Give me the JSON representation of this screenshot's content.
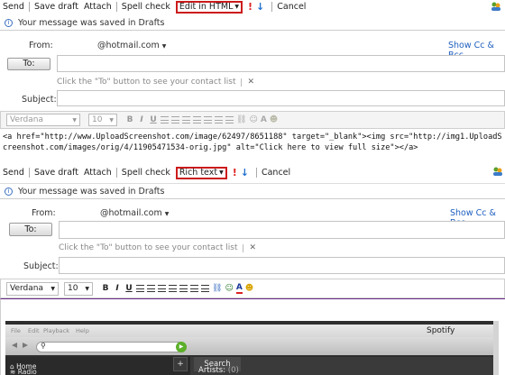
{
  "toolbar_top": {
    "send": "Send",
    "save_draft": "Save draft",
    "attach": "Attach",
    "spell_check": "Spell check",
    "mode": "Edit in HTML",
    "cancel": "Cancel"
  },
  "saved_msg_top": "Your message was saved in Drafts",
  "compose_top": {
    "from_label": "From:",
    "from_value": "@hotmail.com",
    "show_cc": "Show Cc & Bcc",
    "to_button": "To:",
    "hint": "Click the \"To\" button to see your contact list",
    "subject_label": "Subject:",
    "font": "Verdana",
    "size": "10"
  },
  "html_source": "<a href=\"http://www.UploadScreenshot.com/image/62497/8651188\" target=\"_blank\"><img src=\"http://img1.UploadScreenshot.com/images/orig/4/11905471534-orig.jpg\" alt=\"Click here to view full size\"></a>",
  "toolbar_bottom": {
    "send": "Send",
    "save_draft": "Save draft",
    "attach": "Attach",
    "spell_check": "Spell check",
    "mode": "Rich text",
    "cancel": "Cancel"
  },
  "saved_msg_bottom": "Your message was saved in Drafts",
  "compose_bottom": {
    "from_label": "From:",
    "from_value": "@hotmail.com",
    "show_cc": "Show Cc & Bcc",
    "to_button": "To:",
    "hint": "Click the \"To\" button to see your contact list",
    "subject_label": "Subject:",
    "font": "Verdana",
    "size": "10"
  },
  "spotify": {
    "title": "Spotify",
    "menu": [
      "File",
      "Edit",
      "Playback",
      "Help"
    ],
    "search_tab": "Search",
    "nav": [
      "Home",
      "Radio"
    ],
    "artists_label": "Artists:",
    "artists_count": "(0)"
  },
  "colors": {
    "accent_red": "#cc1b1b",
    "link_blue": "#1f5fbf",
    "spotify_bg": "#2b2b2b"
  }
}
